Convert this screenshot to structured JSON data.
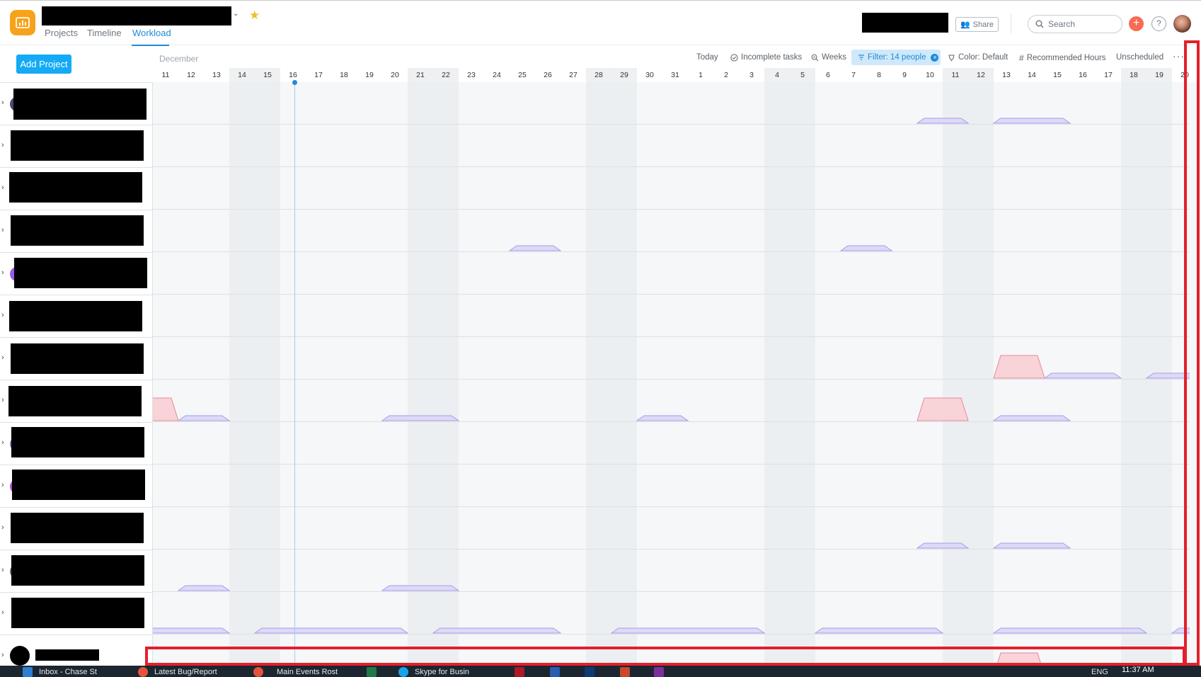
{
  "header": {
    "tabs": [
      {
        "label": "Projects"
      },
      {
        "label": "Timeline"
      },
      {
        "label": "Workload"
      }
    ],
    "share_label": "Share",
    "search_placeholder": "Search",
    "plus_label": "+",
    "help_label": "?"
  },
  "toolbar": {
    "add_project_label": "Add Project",
    "month_label": "December",
    "today_label": "Today",
    "incomplete_label": "Incomplete tasks",
    "weeks_label": "Weeks",
    "filter_label": "Filter: 14 people",
    "color_label": "Color: Default",
    "recommended_label": "Recommended Hours",
    "unscheduled_label": "Unscheduled",
    "more_label": "···"
  },
  "timeline": {
    "days": [
      "11",
      "12",
      "13",
      "14",
      "15",
      "16",
      "17",
      "18",
      "19",
      "20",
      "21",
      "22",
      "23",
      "24",
      "25",
      "26",
      "27",
      "28",
      "29",
      "30",
      "31",
      "1",
      "2",
      "3",
      "4",
      "5",
      "6",
      "7",
      "8",
      "9",
      "10",
      "11",
      "12",
      "13",
      "14",
      "15",
      "16",
      "17",
      "18",
      "19",
      "20"
    ],
    "weekend_indexes": [
      3,
      4,
      10,
      11,
      17,
      18,
      24,
      25,
      31,
      32,
      38,
      39
    ],
    "today_index": 5
  },
  "people_count": 14,
  "colors": {
    "accent": "#14aaf5",
    "tab_active": "#1f8bd6",
    "app_icon": "#f7a21b",
    "workload_ok": "#ddd9f7",
    "workload_over": "#f8d3d8",
    "annotation_frame": "#e2202c"
  },
  "taskbar": {
    "apps": [
      {
        "label": "Inbox - Chase St"
      },
      {
        "label": "Latest Bug/Report"
      },
      {
        "label": "Main Events Rost"
      },
      {
        "label": "Skype for Busin"
      }
    ],
    "tray_lang": "ENG",
    "clock": "11:37 AM"
  },
  "icons": [
    "app-icon",
    "chevron-down-icon",
    "star-icon",
    "people-icon",
    "search-icon",
    "plus-icon",
    "help-icon",
    "check-circle-icon",
    "zoom-icon",
    "filter-icon",
    "color-icon",
    "hash-icon",
    "more-icon",
    "chevron-right-icon"
  ],
  "workload": {
    "rows": [
      {
        "ok": [
          [
            30,
            32
          ],
          [
            33,
            36
          ]
        ],
        "over": []
      },
      {
        "ok": [],
        "over": []
      },
      {
        "ok": [],
        "over": []
      },
      {
        "ok": [
          [
            14,
            16
          ],
          [
            27,
            29
          ]
        ],
        "over": []
      },
      {
        "ok": [],
        "over": []
      },
      {
        "ok": [],
        "over": []
      },
      {
        "ok": [
          [
            35,
            38
          ],
          [
            39,
            41
          ]
        ],
        "over": [
          [
            33,
            35
          ]
        ]
      },
      {
        "ok": [
          [
            1,
            3
          ],
          [
            9,
            12
          ],
          [
            19,
            21
          ],
          [
            33,
            36
          ]
        ],
        "over": [
          [
            -1,
            1
          ],
          [
            30,
            32
          ]
        ]
      },
      {
        "ok": [],
        "over": []
      },
      {
        "ok": [],
        "over": []
      },
      {
        "ok": [
          [
            30,
            32
          ],
          [
            33,
            36
          ]
        ],
        "over": []
      },
      {
        "ok": [
          [
            1,
            3
          ],
          [
            9,
            12
          ]
        ],
        "over": []
      },
      {
        "ok": [
          [
            -1,
            3
          ],
          [
            4,
            10
          ],
          [
            11,
            16
          ],
          [
            18,
            24
          ],
          [
            26,
            31
          ],
          [
            33,
            39
          ],
          [
            40,
            41
          ]
        ],
        "over": []
      },
      {
        "ok": [],
        "over": [
          [
            33,
            35
          ]
        ]
      }
    ]
  }
}
